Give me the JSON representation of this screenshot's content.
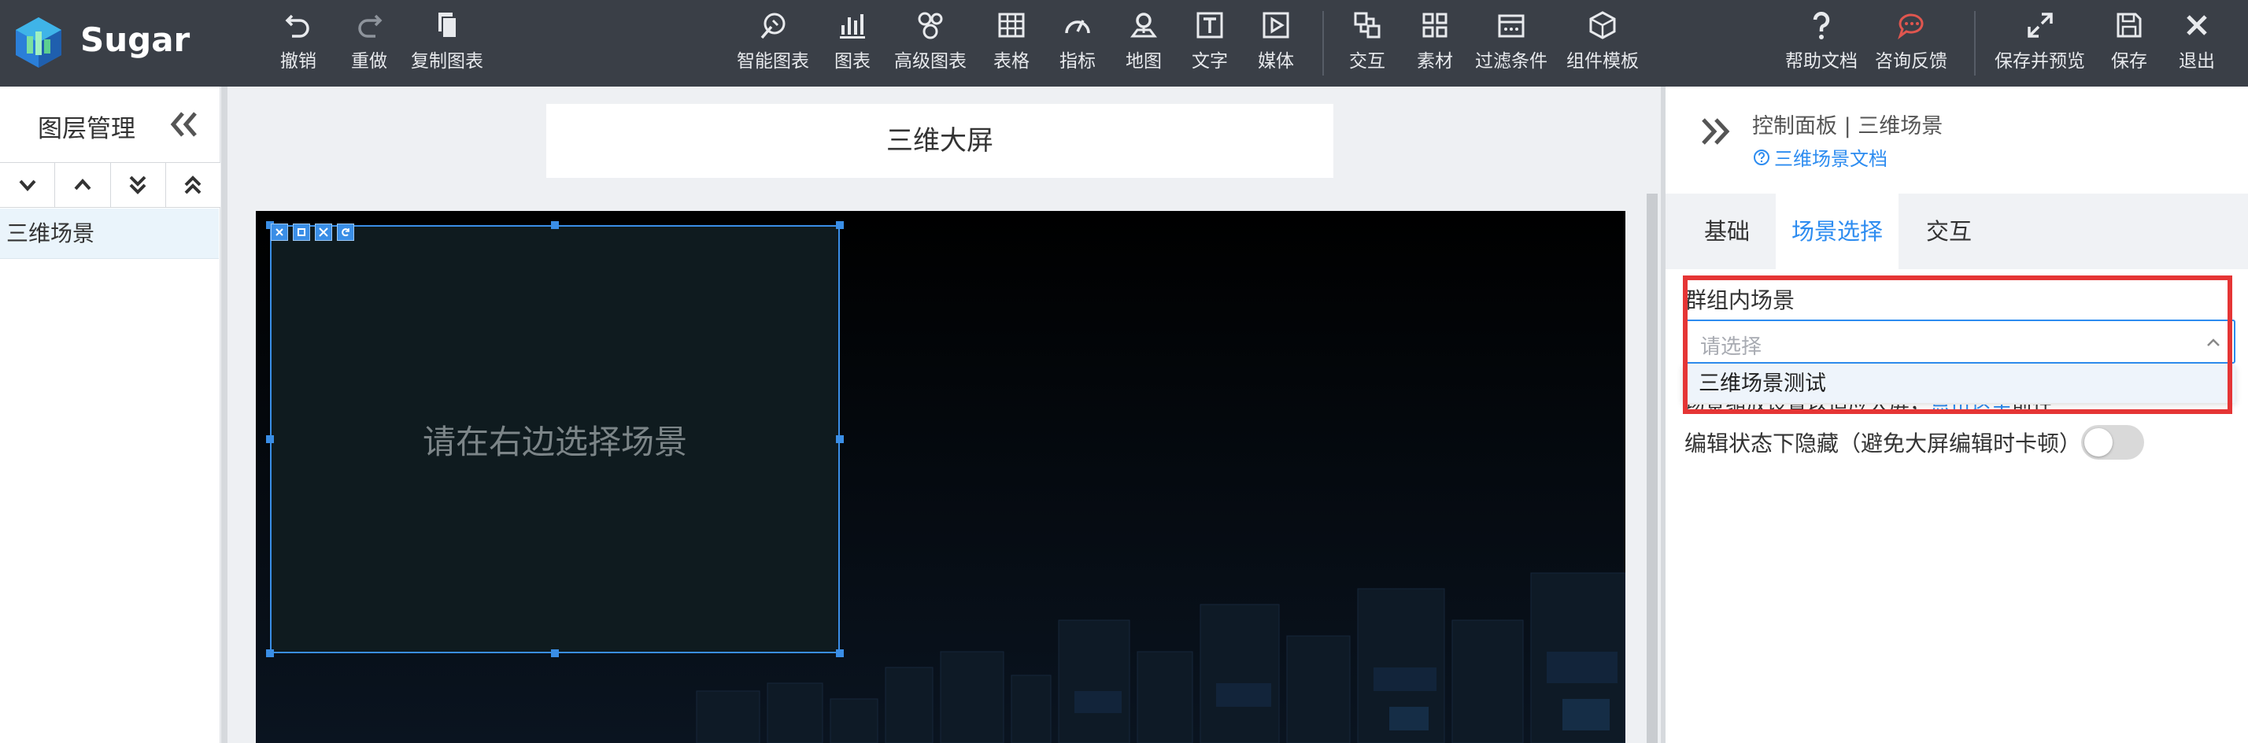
{
  "app": {
    "brand": "Sugar"
  },
  "toolbar": {
    "undo": "撤销",
    "redo": "重做",
    "copy_chart": "复制图表",
    "smart_chart": "智能图表",
    "chart": "图表",
    "advanced_chart": "高级图表",
    "table": "表格",
    "indicator": "指标",
    "map": "地图",
    "text": "文字",
    "media": "媒体",
    "interaction": "交互",
    "material": "素材",
    "filter": "过滤条件",
    "component_template": "组件模板",
    "help_doc": "帮助文档",
    "feedback": "咨询反馈",
    "save_preview": "保存并预览",
    "save": "保存",
    "exit": "退出"
  },
  "left_panel": {
    "title": "图层管理",
    "layers": [
      {
        "label": "三维场景"
      }
    ]
  },
  "canvas": {
    "screen_title": "三维大屏",
    "widget_placeholder": "请在右边选择场景"
  },
  "right_panel": {
    "title": "控制面板 | 三维场景",
    "doc_link": "三维场景文档",
    "tabs": [
      {
        "label": "基础"
      },
      {
        "label": "场景选择"
      },
      {
        "label": "交互"
      }
    ],
    "active_tab": 1,
    "group_scene_label": "群组内场景",
    "select_placeholder": "请选择",
    "dropdown_options": [
      "三维场景测试"
    ],
    "hidden_row_text": "场景缩放设置以适应大屏，",
    "hidden_row_link": "点击这里",
    "hidden_row_tail": "前往",
    "hide_in_edit_label": "编辑状态下隐藏（避免大屏编辑时卡顿）",
    "hide_in_edit_on": false
  },
  "colors": {
    "toolbar_bg": "#3a3f47",
    "accent": "#2d8cf0",
    "highlight_box": "#e53535",
    "stage_bg": "#000000"
  }
}
